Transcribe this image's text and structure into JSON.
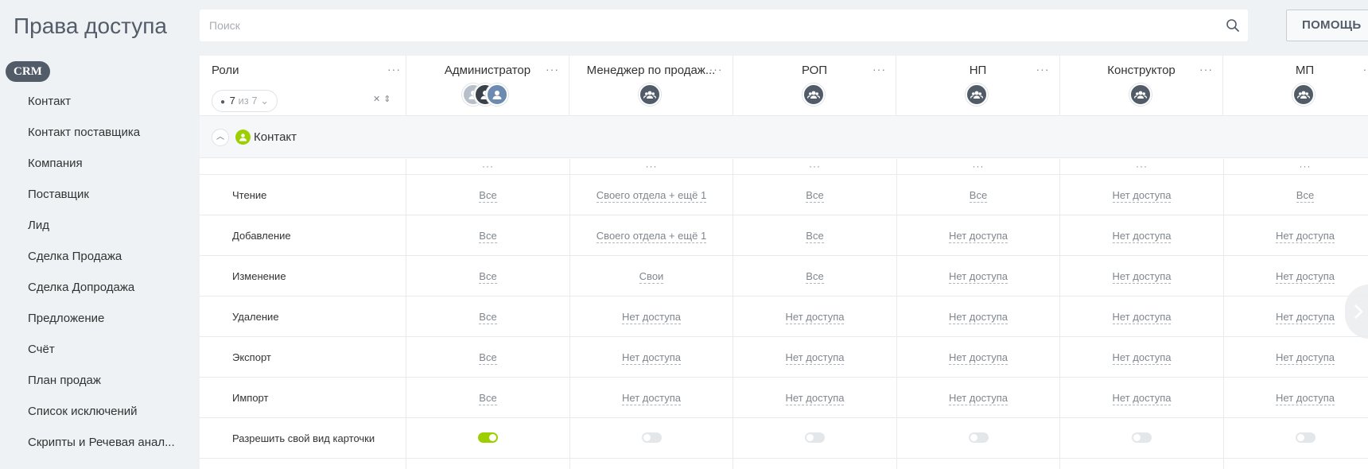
{
  "page": {
    "title": "Права доступа"
  },
  "search": {
    "placeholder": "Поиск"
  },
  "help_button": "ПОМОЩЬ",
  "sidebar": {
    "badge": "CRM",
    "items": [
      "Контакт",
      "Контакт поставщика",
      "Компания",
      "Поставщик",
      "Лид",
      "Сделка Продажа",
      "Сделка Допродажа",
      "Предложение",
      "Счёт",
      "План продаж",
      "Список исключений",
      "Скрипты и Речевая анал..."
    ]
  },
  "roles_header": {
    "title": "Роли",
    "visible_count": "7",
    "total_label": "из 7"
  },
  "roles": [
    {
      "name": "Администратор",
      "avatar": "user-photos"
    },
    {
      "name": "Менеджер по продаж...",
      "avatar": "group-icon"
    },
    {
      "name": "РОП",
      "avatar": "group-icon"
    },
    {
      "name": "НП",
      "avatar": "group-icon"
    },
    {
      "name": "Конструктор",
      "avatar": "group-icon"
    },
    {
      "name": "МП",
      "avatar": "group-icon"
    }
  ],
  "section": {
    "title": "Контакт",
    "icon": "contact-icon",
    "icon_color": "#9dcf00"
  },
  "permissions": [
    {
      "label": "Чтение",
      "values": [
        "Все",
        "Своего отдела + ещё 1",
        "Все",
        "Все",
        "Нет доступа",
        "Все"
      ]
    },
    {
      "label": "Добавление",
      "values": [
        "Все",
        "Своего отдела + ещё 1",
        "Все",
        "Нет доступа",
        "Нет доступа",
        "Нет доступа"
      ]
    },
    {
      "label": "Изменение",
      "values": [
        "Все",
        "Свои",
        "Все",
        "Нет доступа",
        "Нет доступа",
        "Нет доступа"
      ]
    },
    {
      "label": "Удаление",
      "values": [
        "Все",
        "Нет доступа",
        "Нет доступа",
        "Нет доступа",
        "Нет доступа",
        "Нет доступа"
      ]
    },
    {
      "label": "Экспорт",
      "values": [
        "Все",
        "Нет доступа",
        "Нет доступа",
        "Нет доступа",
        "Нет доступа",
        "Нет доступа"
      ]
    },
    {
      "label": "Импорт",
      "values": [
        "Все",
        "Нет доступа",
        "Нет доступа",
        "Нет доступа",
        "Нет доступа",
        "Нет доступа"
      ]
    }
  ],
  "toggle_row": {
    "label": "Разрешить свой вид карточки",
    "values": [
      true,
      false,
      false,
      false,
      false,
      false
    ]
  },
  "colors": {
    "accent_green": "#9dcf00",
    "badge_dark": "#525c69",
    "toggle_off": "#e4e7ea"
  }
}
